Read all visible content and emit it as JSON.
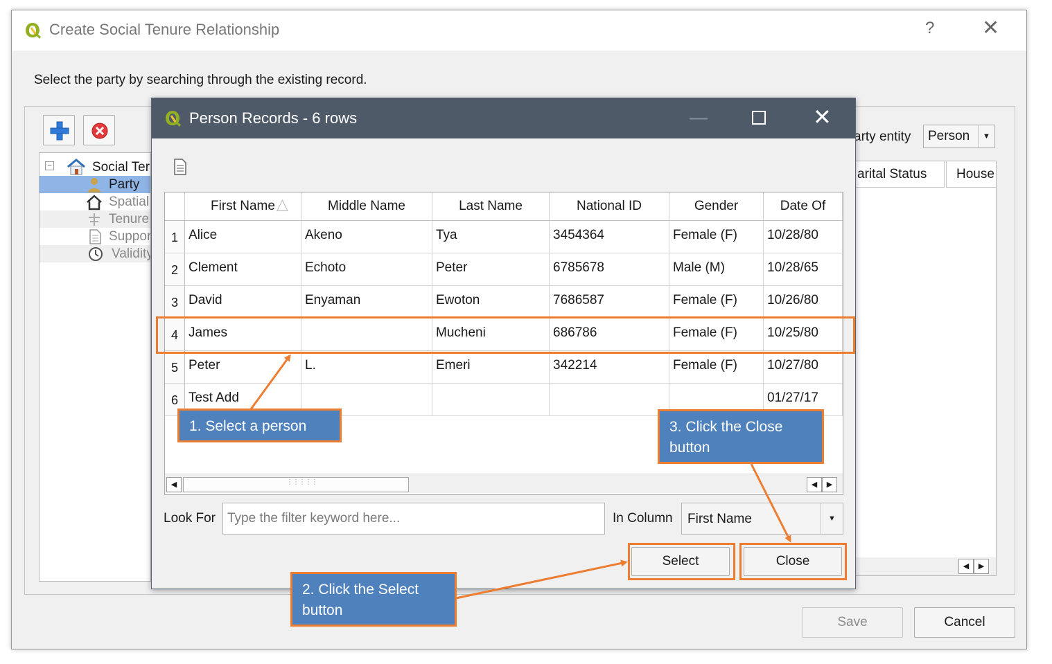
{
  "outer_dialog": {
    "title": "Create Social Tenure Relationship",
    "help_label": "?",
    "instruction": "Select the party by searching through the existing record.",
    "tree": [
      {
        "label": "Social Ter"
      },
      {
        "label": "Party"
      },
      {
        "label": "Spatial"
      },
      {
        "label": "Tenure"
      },
      {
        "label": "Suppor"
      },
      {
        "label": "Validity"
      }
    ],
    "party_entity_label": "arty entity",
    "party_entity_value": "Person",
    "right_columns": [
      "arital Status",
      "House"
    ],
    "save_label": "Save",
    "cancel_label": "Cancel"
  },
  "inner_dialog": {
    "title": "Person Records - 6 rows",
    "columns": [
      "First Name",
      "Middle Name",
      "Last Name",
      "National ID",
      "Gender",
      "Date Of"
    ],
    "rows": [
      {
        "num": "1",
        "cells": [
          "Alice",
          "Akeno",
          "Tya",
          "3454364",
          "Female (F)",
          "10/28/80"
        ]
      },
      {
        "num": "2",
        "cells": [
          "Clement",
          "Echoto",
          "Peter",
          "6785678",
          "Male (M)",
          "10/28/65"
        ]
      },
      {
        "num": "3",
        "cells": [
          "David",
          "Enyaman",
          "Ewoton",
          "7686587",
          "Female (F)",
          "10/26/80"
        ]
      },
      {
        "num": "4",
        "cells": [
          "James",
          "",
          "Mucheni",
          "686786",
          "Female (F)",
          "10/25/80"
        ]
      },
      {
        "num": "5",
        "cells": [
          "Peter",
          "L.",
          "Emeri",
          "342214",
          "Female (F)",
          "10/27/80"
        ]
      },
      {
        "num": "6",
        "cells": [
          "Test Add",
          "",
          "",
          "",
          "",
          "01/27/17"
        ]
      }
    ],
    "look_for_label": "Look For",
    "filter_placeholder": "Type the filter keyword here...",
    "in_column_label": "In Column",
    "in_column_value": "First Name",
    "select_label": "Select",
    "close_label": "Close"
  },
  "annotations": {
    "step1": "1. Select a person",
    "step2": "2. Click the Select button",
    "step3": "3. Click the Close button"
  },
  "colors": {
    "highlight": "#ed7d31",
    "callout_bg": "#4f81bd",
    "titlebar": "#4e5a68",
    "selected_tree_item": "#8fb4e6"
  }
}
